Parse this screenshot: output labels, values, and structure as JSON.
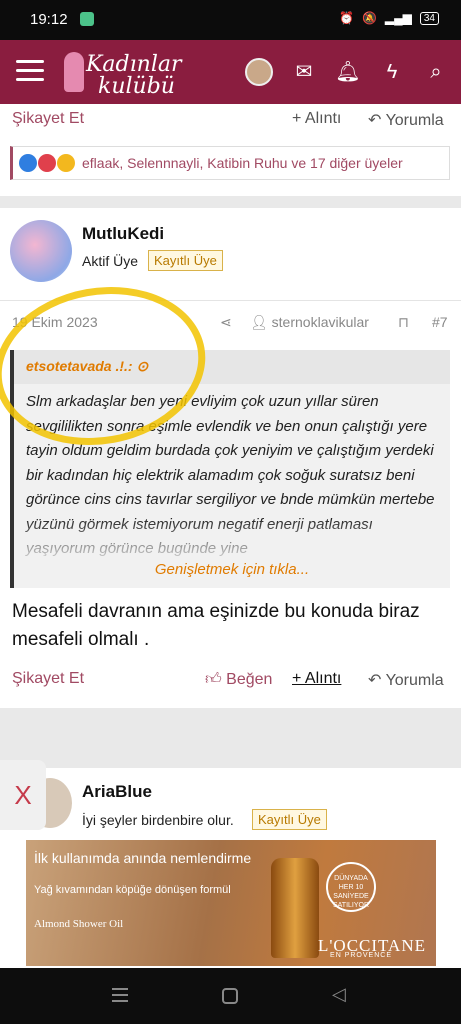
{
  "status_bar": {
    "time": "19:12",
    "battery": "34"
  },
  "header": {
    "logo_line1": "Kadınlar",
    "logo_line2": "kulübü",
    "icons": [
      "menu-icon",
      "avatar",
      "envelope-icon",
      "bell-icon",
      "lightning-icon",
      "search-icon"
    ]
  },
  "prev_post": {
    "report": "Şikayet Et",
    "quote": "+ Alıntı",
    "reply": "Yorumla",
    "reactions_text": "eflaak, Selennnayli, Katibin Ruhu ve 17 diğer üyeler"
  },
  "post": {
    "username": "MutluKedi",
    "user_title": "Aktif Üye",
    "badge": "Kayıtlı Üye",
    "date": "19 Ekim 2023",
    "share_user": "sternoklavikular",
    "number": "#7",
    "quote_author": "etsotetavada .!.: ",
    "quote_text": "Slm arkadaşlar ben yeni evliyim çok uzun yıllar süren sevgililikten sonra eşimle evlendik ve ben onun çalıştığı yere tayin oldum geldim burdada çok yeniyim ve çalıştığım yerdeki bir kadından hiç elektrik alamadım çok soğuk suratsız beni görünce cins cins tavırlar sergiliyor ve bnde mümkün mertebe yüzünü görmek istemiyorum negatif enerji patlaması yaşıyorum görünce bugünde yine",
    "expand": "Genişletmek için tıkla...",
    "reply_text": "Mesafeli davranın ama eşinizde bu konuda biraz mesafeli olmalı .",
    "report": "Şikayet Et",
    "like": "Beğen",
    "quote": "+ Alıntı",
    "reply": "Yorumla"
  },
  "next_post": {
    "username": "AriaBlue",
    "user_title": "İyi şeyler birdenbire olur.",
    "badge": "Kayıtlı Üye"
  },
  "ad": {
    "close": "X",
    "line1": "İlk kullanımda anında nemlendirme",
    "line2": "Yağ kıvamından köpüğe dönüşen formül",
    "line3": "Almond Shower Oil",
    "badge_text": "DÜNYADA HER 10 SANİYEDE SATILIYOR",
    "brand": "L'OCCITANE",
    "brand_sub": "EN PROVENCE"
  }
}
